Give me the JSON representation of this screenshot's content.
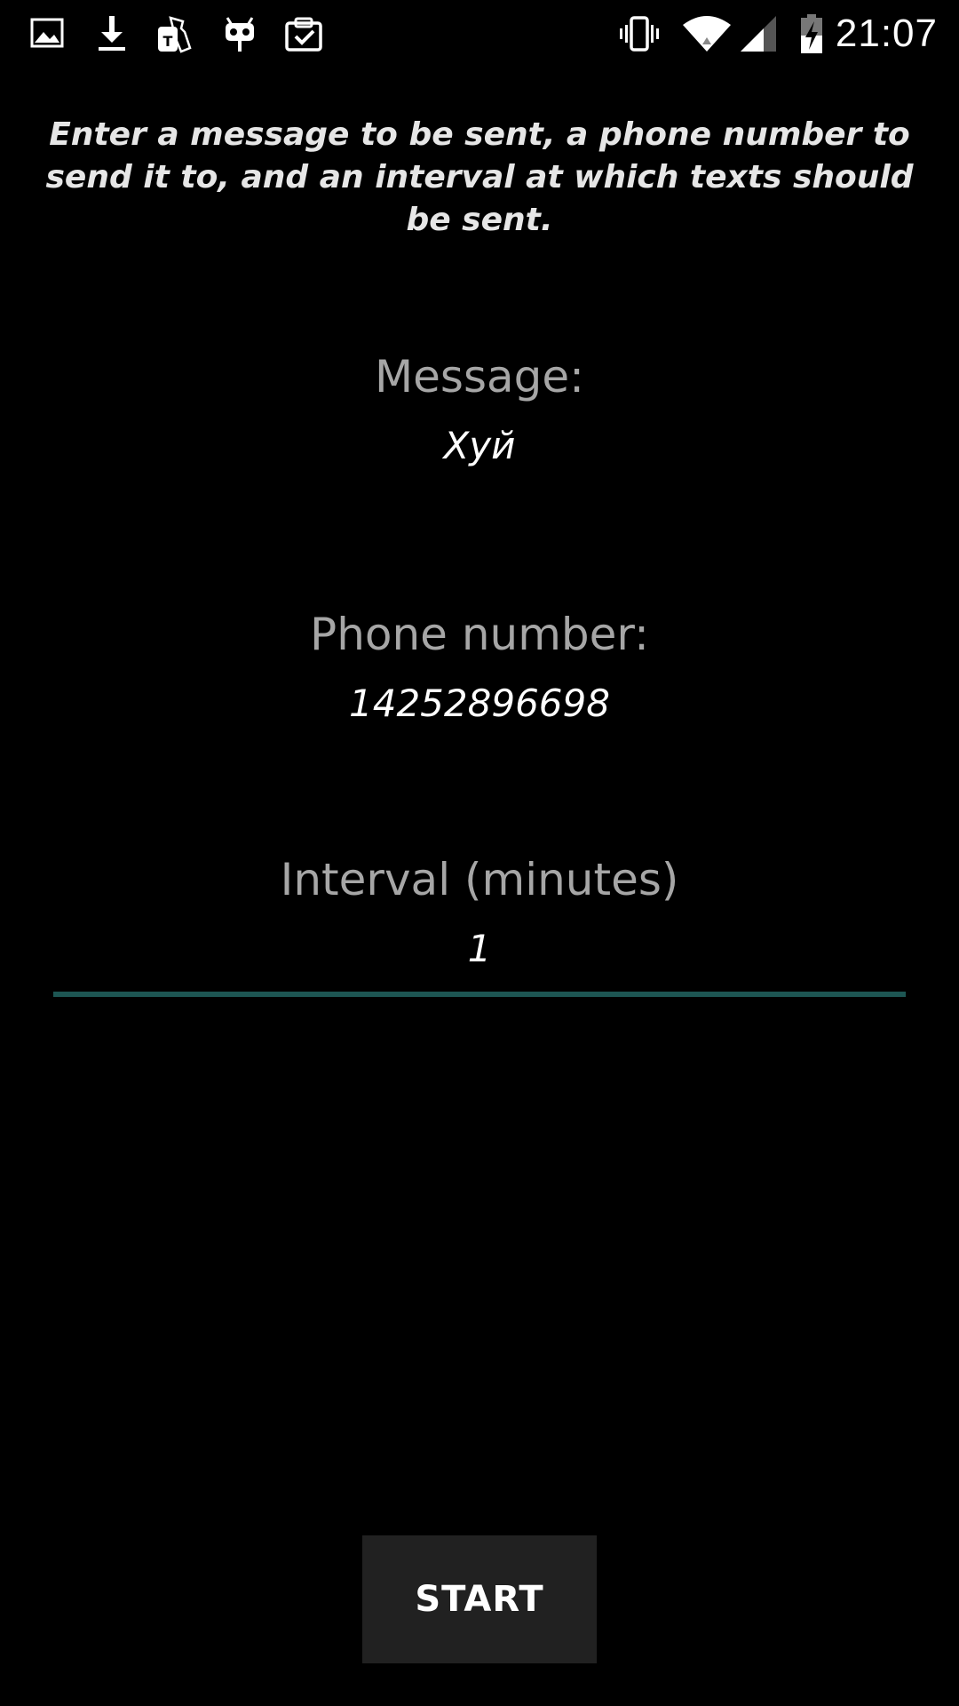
{
  "status_bar": {
    "time": "21:07",
    "left_icons": [
      "image-icon",
      "download-icon",
      "t-mobile-tags-icon",
      "cyanogenmod-icon",
      "clipboard-check-icon"
    ],
    "right_icons": [
      "vibrate-icon",
      "wifi-icon",
      "cell-signal-icon",
      "battery-charging-icon"
    ]
  },
  "instructions": "Enter a message to be sent, a phone number to send it to, and an interval at which texts should be sent.",
  "form": {
    "message": {
      "label": "Message:",
      "value": "Хуй"
    },
    "phone": {
      "label": "Phone number:",
      "value": "14252896698"
    },
    "interval": {
      "label": "Interval (minutes)",
      "value": "1"
    }
  },
  "start_button": {
    "label": "START"
  },
  "colors": {
    "background": "#000000",
    "label": "#a6a6a6",
    "accent_underline": "#1d5653",
    "button_bg": "#212121"
  }
}
